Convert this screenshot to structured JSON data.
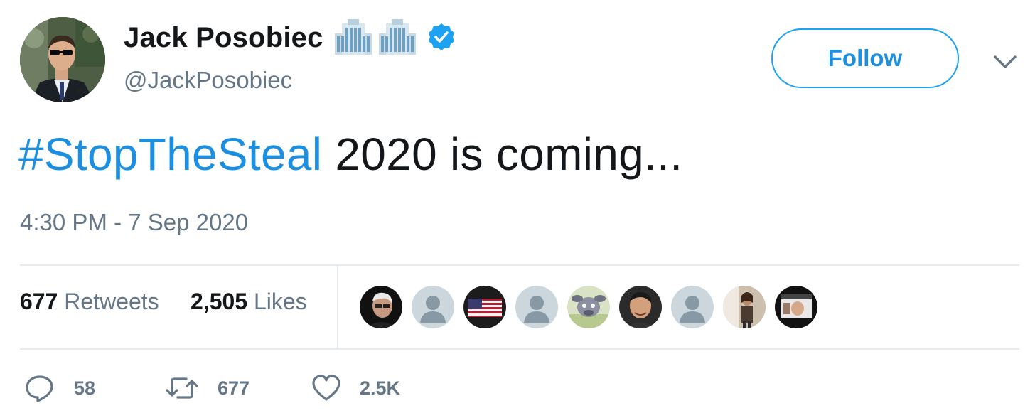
{
  "author": {
    "display_name": "Jack Posobiec",
    "name_emojis": [
      "building-emoji",
      "building-emoji"
    ],
    "verified": true,
    "handle": "@JackPosobiec"
  },
  "follow_button": {
    "label": "Follow"
  },
  "tweet": {
    "hashtag": "#StopTheSteal",
    "text": " 2020 is coming...",
    "timestamp": "4:30 PM - 7 Sep 2020"
  },
  "stats": {
    "retweets_count": "677",
    "retweets_label": "Retweets",
    "likes_count": "2,505",
    "likes_label": "Likes"
  },
  "likers": [
    "photo-avatar",
    "default-avatar",
    "flag-avatar",
    "default-avatar",
    "cartoon-avatar",
    "photo-avatar",
    "default-avatar",
    "photo-avatar",
    "photo-avatar"
  ],
  "actions": {
    "reply_count": "58",
    "retweet_count": "677",
    "like_count": "2.5K"
  },
  "colors": {
    "accent": "#1da1f2",
    "link": "#1d8fe0",
    "muted": "#657786",
    "text": "#14171a",
    "divider": "#e6ecf0"
  }
}
